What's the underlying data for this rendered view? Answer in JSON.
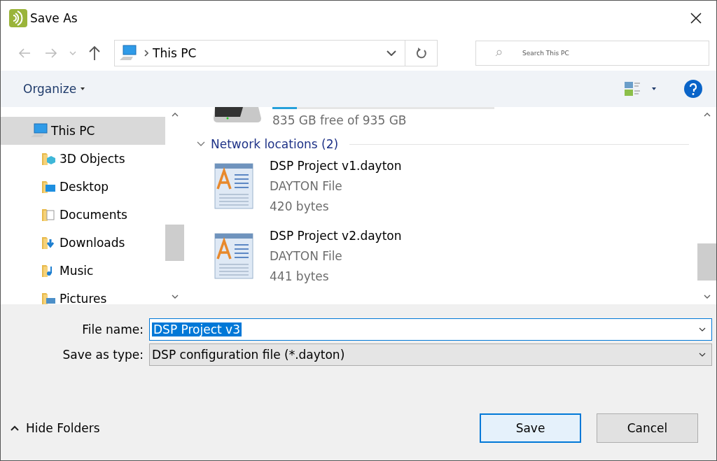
{
  "window": {
    "title": "Save As"
  },
  "address_bar": {
    "location": "This PC"
  },
  "search": {
    "placeholder": "Search This PC"
  },
  "toolbar": {
    "organize": "Organize"
  },
  "sidebar": {
    "items": [
      {
        "label": "This PC",
        "selected": true,
        "children": [
          {
            "label": "3D Objects",
            "selected": false
          },
          {
            "label": "Desktop",
            "selected": false
          },
          {
            "label": "Documents",
            "selected": false
          },
          {
            "label": "Downloads",
            "selected": false
          },
          {
            "label": "Music",
            "selected": false
          },
          {
            "label": "Pictures",
            "selected": false
          }
        ]
      }
    ]
  },
  "drive": {
    "space": "835 GB free of 935 GB",
    "level": 0.11
  },
  "group": {
    "title": "Network locations (2)",
    "expanded": true
  },
  "files": [
    {
      "name": "DSP Project v1.dayton",
      "type": "DAYTON File",
      "size": "420 bytes"
    },
    {
      "name": "DSP Project v2.dayton",
      "type": "DAYTON File",
      "size": "441 bytes"
    }
  ],
  "form": {
    "file_name_label": "File name:",
    "file_name": "DSP Project v3",
    "type_label": "Save as type:",
    "type_value": "DSP configuration file (*.dayton)"
  },
  "hide_folders": "Hide Folders",
  "buttons": [
    {
      "label": "Save",
      "kind": "default"
    },
    {
      "label": "Cancel",
      "kind": "normal"
    }
  ]
}
